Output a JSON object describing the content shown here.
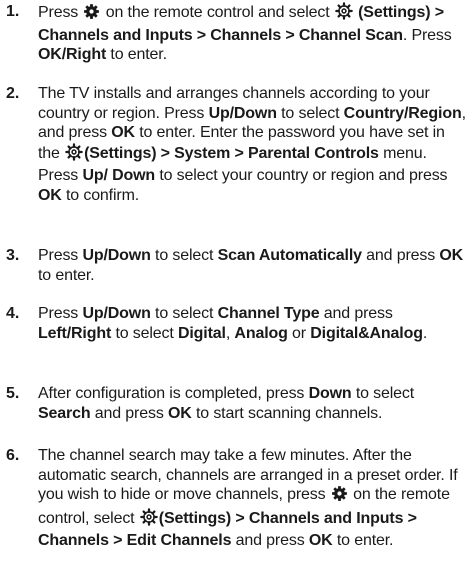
{
  "icons": {
    "gear": "gear-icon",
    "settings": "settings-icon"
  },
  "steps": [
    {
      "number": "1.",
      "parts": [
        {
          "t": "Press ",
          "b": false
        },
        {
          "icon": "gear"
        },
        {
          "t": " on the remote control and select ",
          "b": false
        },
        {
          "icon": "settings"
        },
        {
          "t": " (Settings) > Channels and Inputs > Channels > Channel Scan",
          "b": true
        },
        {
          "t": ". Press ",
          "b": false
        },
        {
          "t": "OK/Right",
          "b": true
        },
        {
          "t": " to enter.",
          "b": false
        }
      ]
    },
    {
      "number": "2.",
      "parts": [
        {
          "t": "The TV installs and arranges channels according to your country or region. Press ",
          "b": false
        },
        {
          "t": "Up/Down",
          "b": true
        },
        {
          "t": " to select ",
          "b": false
        },
        {
          "t": "Country/Region",
          "b": true
        },
        {
          "t": ", and press ",
          "b": false
        },
        {
          "t": "OK",
          "b": true
        },
        {
          "t": " to enter. Enter the password you have set in the ",
          "b": false
        },
        {
          "icon": "settings"
        },
        {
          "t": "(Settings) > System > Parental Controls",
          "b": true
        },
        {
          "t": " menu. Press ",
          "b": false
        },
        {
          "t": "Up/ Down",
          "b": true
        },
        {
          "t": " to select your country or region and press ",
          "b": false
        },
        {
          "t": "OK",
          "b": true
        },
        {
          "t": " to confirm.",
          "b": false
        }
      ]
    },
    {
      "number": "3.",
      "parts": [
        {
          "t": "Press ",
          "b": false
        },
        {
          "t": "Up/Down",
          "b": true
        },
        {
          "t": " to select ",
          "b": false
        },
        {
          "t": "Scan Automatically",
          "b": true
        },
        {
          "t": " and press ",
          "b": false
        },
        {
          "t": "OK",
          "b": true
        },
        {
          "t": " to enter.",
          "b": false
        }
      ]
    },
    {
      "number": "4.",
      "parts": [
        {
          "t": "Press ",
          "b": false
        },
        {
          "t": "Up/Down",
          "b": true
        },
        {
          "t": " to select ",
          "b": false
        },
        {
          "t": "Channel Type",
          "b": true
        },
        {
          "t": " and press ",
          "b": false
        },
        {
          "t": "Left/Right",
          "b": true
        },
        {
          "t": " to select ",
          "b": false
        },
        {
          "t": "Digital",
          "b": true
        },
        {
          "t": ", ",
          "b": false
        },
        {
          "t": "Analog",
          "b": true
        },
        {
          "t": " or ",
          "b": false
        },
        {
          "t": "Digital&Analog",
          "b": true
        },
        {
          "t": ".",
          "b": false
        }
      ]
    },
    {
      "number": "5.",
      "parts": [
        {
          "t": "After configuration is completed, press ",
          "b": false
        },
        {
          "t": "Down",
          "b": true
        },
        {
          "t": " to select ",
          "b": false
        },
        {
          "t": "Search",
          "b": true
        },
        {
          "t": " and press ",
          "b": false
        },
        {
          "t": "OK",
          "b": true
        },
        {
          "t": " to start scanning channels.",
          "b": false
        }
      ]
    },
    {
      "number": "6.",
      "parts": [
        {
          "t": "The channel search may take a few minutes. After the automatic search, channels are arranged in a preset order. If you wish to hide or move channels, press ",
          "b": false
        },
        {
          "icon": "gear"
        },
        {
          "t": " on the remote control, select ",
          "b": false
        },
        {
          "icon": "settings"
        },
        {
          "t": "(Settings) > Channels and Inputs > Channels > Edit Channels",
          "b": true
        },
        {
          "t": " and press ",
          "b": false
        },
        {
          "t": "OK",
          "b": true
        },
        {
          "t": " to enter.",
          "b": false
        }
      ]
    }
  ]
}
